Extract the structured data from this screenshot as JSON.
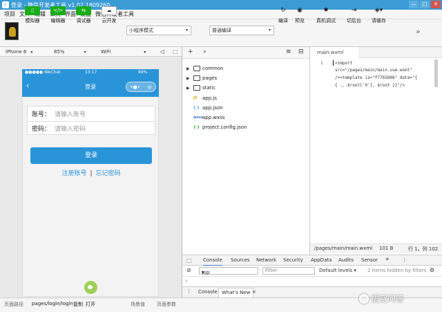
{
  "window": {
    "title": "登录 - 微信开发者工具 v1.02.1809260",
    "min": "—",
    "max": "□",
    "close": "✕"
  },
  "menu": [
    "项目",
    "文件",
    "编辑",
    "工具",
    "界面",
    "设置",
    "微信开发者工具"
  ],
  "toolbar": {
    "simulator": "模拟器",
    "editor": "编辑器",
    "debugger": "调试器",
    "cloud": "云开发",
    "mode": "小程序模式",
    "compile": "普通编译",
    "compile_btn": "编译",
    "preview": "预览",
    "remote_debug": "真机调试",
    "backend": "切后台",
    "clear_cache": "清缓存",
    "more": "»"
  },
  "device": {
    "model": "iPhone 6",
    "zoom": "85%",
    "network": "WiFi"
  },
  "phone": {
    "carrier": "●●●●● WeChat",
    "time": "13:17",
    "battery": "99%",
    "nav_title": "登录",
    "account_label": "账号：",
    "account_placeholder": "请输入账号",
    "password_label": "密码：",
    "password_placeholder": "请输入密码",
    "login_btn": "登录",
    "register": "注册账号",
    "separator": "|",
    "forgot": "忘记密码"
  },
  "files": [
    {
      "name": "common",
      "type": "folder"
    },
    {
      "name": "pages",
      "type": "folder"
    },
    {
      "name": "static",
      "type": "folder"
    },
    {
      "name": "app.js",
      "type": "js",
      "tag": "JS"
    },
    {
      "name": "app.json",
      "type": "json",
      "tag": "{ }"
    },
    {
      "name": "app.wxss",
      "type": "wxss",
      "tag": "wxss"
    },
    {
      "name": "project.config.json",
      "type": "config",
      "tag": "{·}"
    }
  ],
  "editor": {
    "tab": "main.wxml",
    "line_number": "1",
    "lines": [
      "<import",
      "src=\"/pages/main/main.vue.wxml\"",
      "/><template is=\"f77b5806\" data=\"{",
      "{ ...$root['0'], $root }}\"/>"
    ],
    "path": "/pages/main/main.wxml",
    "size": "101 B",
    "position": "行 1，列 102"
  },
  "devtools": {
    "tabs": [
      "Console",
      "Sources",
      "Network",
      "Security",
      "AppData",
      "Audits",
      "Sensor"
    ],
    "more": "»",
    "context": "top",
    "filter_placeholder": "Filter",
    "levels": "Default levels ▾",
    "hidden": "2 items hidden by filters",
    "prompt": "›",
    "drawer_tabs": [
      "Console",
      "What's New"
    ],
    "drawer_close": "×"
  },
  "statusbar": {
    "path_label": "页面路径",
    "path": "pages/login/login",
    "copy": "复制",
    "open": "打开",
    "scene": "场景值",
    "params": "页面参数"
  },
  "watermark": "悟空问答"
}
